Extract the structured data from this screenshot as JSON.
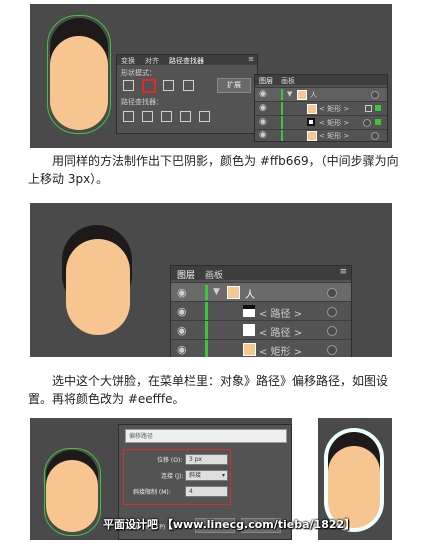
{
  "panel1": {
    "tabs": [
      "变换",
      "对齐",
      "路径查找器"
    ],
    "shape_modes_label": "形状模式：",
    "expand_label": "扩展",
    "pathfinder_label": "路径查找器：",
    "layers_tabs": [
      "图层",
      "画板"
    ],
    "layers": [
      {
        "name": "人"
      },
      {
        "name": "< 矩形 >"
      },
      {
        "name": "< 矩形 >"
      },
      {
        "name": "< 矩形 >"
      }
    ]
  },
  "text1": "用同样的方法制作出下巴阴影，颜色为 #ffb669，（中间步骤为向上移动 3px）。",
  "panel2": {
    "layers_tabs": [
      "图层",
      "画板"
    ],
    "layers": [
      {
        "name": "人"
      },
      {
        "name": "< 路径 >"
      },
      {
        "name": "< 路径 >"
      },
      {
        "name": "< 矩形 >"
      }
    ]
  },
  "text2": "选中这个大饼脸，在菜单栏里：对象》路径》偏移路径，如图设置。再将颜色改为 #eefffe。",
  "dialog": {
    "title": "偏移路径",
    "offset_label": "位移 (O):",
    "offset_value": "3 px",
    "joins_label": "连接 (J):",
    "joins_value": "斜接",
    "miter_label": "斜接限制 (M):",
    "miter_value": "4",
    "preview_label": "预览 (P)",
    "ok_label": "确定",
    "cancel_label": "取消"
  },
  "watermark": "平面设计吧 【www.linecg.com/tieba/1822】",
  "colors": {
    "face": "#f7c690",
    "hair": "#1e1a19",
    "chin_shadow": "#ffb669",
    "outline": "#eefffe",
    "panel_bg": "#535353",
    "layer_green": "#3ec43e"
  }
}
